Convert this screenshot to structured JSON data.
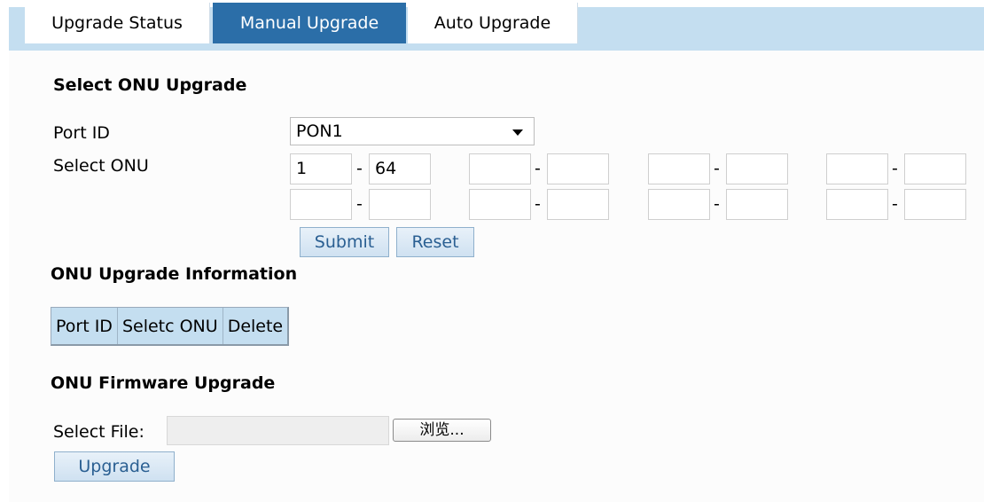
{
  "tabs": [
    "Upgrade Status",
    "Manual Upgrade",
    "Auto Upgrade"
  ],
  "select_section": {
    "title": "Select ONU Upgrade",
    "port_label": "Port ID",
    "port_value": "PON1",
    "onu_label": "Select ONU",
    "ranges": [
      {
        "from": "1",
        "to": "64"
      },
      {
        "from": "",
        "to": ""
      },
      {
        "from": "",
        "to": ""
      },
      {
        "from": "",
        "to": ""
      },
      {
        "from": "",
        "to": ""
      },
      {
        "from": "",
        "to": ""
      },
      {
        "from": "",
        "to": ""
      },
      {
        "from": "",
        "to": ""
      }
    ],
    "dash": "-",
    "submit": "Submit",
    "reset": "Reset"
  },
  "info_section": {
    "title": "ONU Upgrade Information",
    "columns": [
      "Port ID",
      "Seletc ONU",
      "Delete"
    ]
  },
  "firmware_section": {
    "title": "ONU Firmware Upgrade",
    "file_label": "Select File:",
    "file_value": "",
    "browse": "浏览...",
    "upgrade": "Upgrade"
  }
}
